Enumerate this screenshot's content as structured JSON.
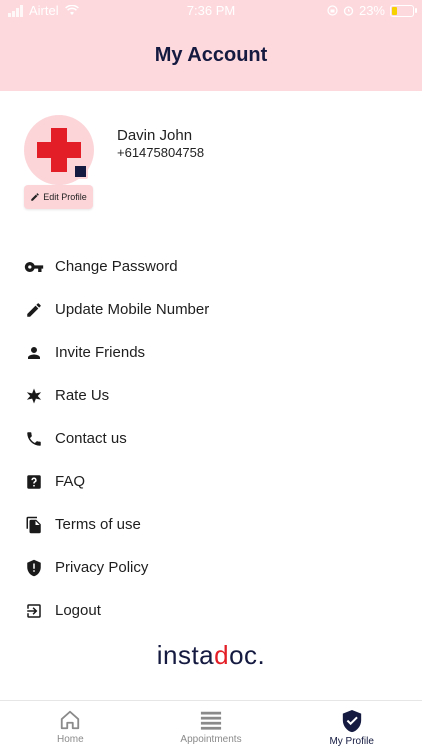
{
  "status_bar": {
    "carrier": "Airtel",
    "time": "7:36 PM",
    "battery": "23%"
  },
  "header": {
    "title": "My Account"
  },
  "profile": {
    "name": "Davin John",
    "phone": "+61475804758",
    "edit_label": "Edit Profile"
  },
  "menu": [
    {
      "label": "Change Password",
      "icon": "key-icon"
    },
    {
      "label": "Update Mobile Number",
      "icon": "pencil-icon"
    },
    {
      "label": "Invite Friends",
      "icon": "person-icon"
    },
    {
      "label": "Rate Us",
      "icon": "star-icon"
    },
    {
      "label": "Contact us",
      "icon": "phone-icon"
    },
    {
      "label": "FAQ",
      "icon": "question-icon"
    },
    {
      "label": "Terms of use",
      "icon": "document-icon"
    },
    {
      "label": "Privacy Policy",
      "icon": "shield-icon"
    },
    {
      "label": "Logout",
      "icon": "logout-icon"
    }
  ],
  "brand": {
    "prefix": "insta",
    "d": "d",
    "suffix": "oc."
  },
  "tabs": [
    {
      "label": "Home",
      "icon": "home-icon",
      "active": false
    },
    {
      "label": "Appointments",
      "icon": "list-icon",
      "active": false
    },
    {
      "label": "My Profile",
      "icon": "shield-check-icon",
      "active": true
    }
  ],
  "colors": {
    "header_bg": "#fdd9de",
    "navy": "#141a40",
    "red": "#e41e26",
    "battery": "#f5d200"
  }
}
